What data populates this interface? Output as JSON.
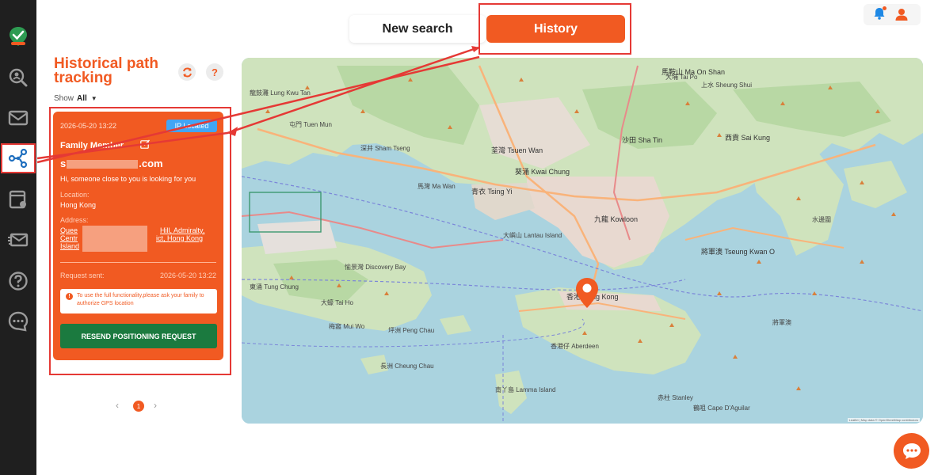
{
  "tabs": {
    "new_search": "New search",
    "history": "History"
  },
  "sidebar": {
    "items": [
      {
        "icon": "search-person-icon"
      },
      {
        "icon": "mail-icon"
      },
      {
        "icon": "path-tracking-icon",
        "active": true
      },
      {
        "icon": "browser-location-icon"
      },
      {
        "icon": "send-message-icon"
      },
      {
        "icon": "help-icon"
      },
      {
        "icon": "chat-bubble-icon"
      }
    ]
  },
  "panel": {
    "title": "Historical path tracking",
    "show_label": "Show",
    "show_value": "All",
    "help_symbol": "?"
  },
  "card": {
    "date": "2026-05-20 13:22",
    "badge": "IP Located",
    "name": "Family Member",
    "email_prefix": "s",
    "email_suffix": ".com",
    "message": "Hi, someone close to you is looking for you",
    "location_label": "Location:",
    "location_value": "Hong Kong",
    "address_label": "Address:",
    "address_line1_a": "Quee",
    "address_line1_b": "Hill, Admiralty,",
    "address_line2_a": "Centr",
    "address_line2_b": "ict, Hong Kong",
    "address_line3": "Island",
    "request_label": "Request sent:",
    "request_date": "2026-05-20 13:22",
    "notice": "To use the full functionality,please ask your family to authorize GPS location",
    "resend_button": "RESEND POSITIONING REQUEST"
  },
  "pagination": {
    "current": "1",
    "prev": "‹",
    "next": "›"
  },
  "map": {
    "labels": [
      "屯門 Tuen Mun",
      "深井 Sham Tseng",
      "荃灣 Tsuen Wan",
      "葵涌 Kwai Chung",
      "沙田 Sha Tin",
      "青衣 Tsing Yi",
      "馬灣 Ma Wan",
      "九龍 Kowloon",
      "香港 Hong Kong",
      "大嶼山 Lantau Island",
      "西貢 Sai Kung",
      "將軍澳 Tseung Kwan O",
      "南丫島 Lamma Island",
      "赤柱 Stanley",
      "大埔 Tai Po",
      "馬鞍山 Ma On Shan",
      "愉景灣 Discovery Bay",
      "東涌 Tung Chung",
      "梅窩 Mui Wo",
      "長洲 Cheung Chau",
      "香港仔 Aberdeen",
      "上水 Sheung Shui",
      "鶴咀 Cape D'Aguilar",
      "坪洲 Peng Chau",
      "龍鼓灘 Lung Kwu Tan",
      "大蠔 Tai Ho",
      "水邊圍",
      "將軍澳"
    ],
    "attribution": "Leaflet | Map data © OpenStreetMap contributors"
  },
  "colors": {
    "accent": "#f15a22",
    "sidebar": "#1f1f1f",
    "badge": "#42a5f5",
    "resend": "#1b7a3f"
  }
}
